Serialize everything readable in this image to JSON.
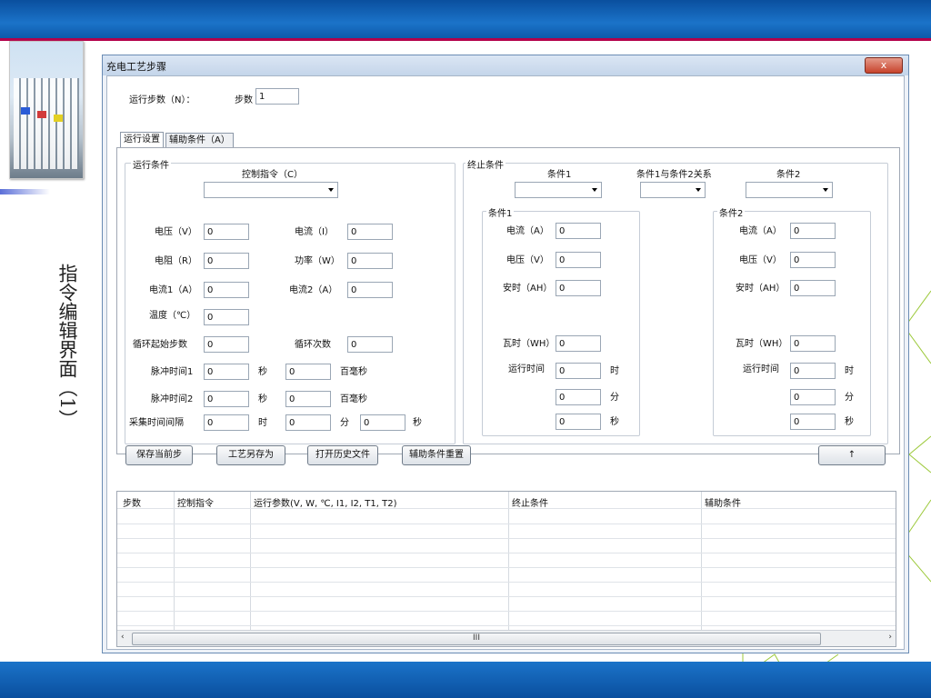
{
  "slide": {
    "title": "指令编辑界面（1）"
  },
  "window": {
    "title": "充电工艺步骤",
    "close_glyph": "x"
  },
  "header": {
    "run_step_label": "运行步数（N）：",
    "step_label": "步数",
    "step_value": "1"
  },
  "tabs": [
    {
      "label": "运行设置"
    },
    {
      "label": "辅助条件（A）"
    }
  ],
  "run_conditions": {
    "group_title": "运行条件",
    "control_label": "控制指令（C）",
    "voltage_label": "电压（V）",
    "voltage_value": "0",
    "current_label": "电流（I）",
    "current_value": "0",
    "resistance_label": "电阻（R）",
    "resistance_value": "0",
    "power_label": "功率（W）",
    "power_value": "0",
    "current1_label": "电流1（A）",
    "current1_value": "0",
    "current2_label": "电流2（A）",
    "current2_value": "0",
    "temp_label": "温度（℃）",
    "temp_value": "0",
    "loop_start_label": "循环起始步数",
    "loop_start_value": "0",
    "loop_count_label": "循环次数",
    "loop_count_value": "0",
    "pulse1_label": "脉冲时间1",
    "pulse1_value": "0",
    "pulse1_unit": "秒",
    "pulse1_ms_value": "0",
    "pulse1_ms_unit": "百毫秒",
    "pulse2_label": "脉冲时间2",
    "pulse2_value": "0",
    "pulse2_unit": "秒",
    "pulse2_ms_value": "0",
    "pulse2_ms_unit": "百毫秒",
    "sample_label": "采集时间间隔",
    "sample_h_value": "0",
    "sample_h_unit": "时",
    "sample_m_value": "0",
    "sample_m_unit": "分",
    "sample_s_value": "0",
    "sample_s_unit": "秒"
  },
  "termination": {
    "group_title": "终止条件",
    "cond1_header": "条件1",
    "relation_header": "条件1与条件2关系",
    "cond2_header": "条件2",
    "cond1": {
      "title": "条件1",
      "current_label": "电流（A）",
      "current_value": "0",
      "voltage_label": "电压（V）",
      "voltage_value": "0",
      "ah_label": "安时（AH）",
      "ah_value": "0",
      "wh_label": "瓦时（WH）",
      "wh_value": "0",
      "runtime_label": "运行时间",
      "runtime_h_value": "0",
      "runtime_h_unit": "时",
      "runtime_m_value": "0",
      "runtime_m_unit": "分",
      "runtime_s_value": "0",
      "runtime_s_unit": "秒"
    },
    "cond2": {
      "title": "条件2",
      "current_label": "电流（A）",
      "current_value": "0",
      "voltage_label": "电压（V）",
      "voltage_value": "0",
      "ah_label": "安时（AH）",
      "ah_value": "0",
      "wh_label": "瓦时（WH）",
      "wh_value": "0",
      "runtime_label": "运行时间",
      "runtime_h_value": "0",
      "runtime_h_unit": "时",
      "runtime_m_value": "0",
      "runtime_m_unit": "分",
      "runtime_s_value": "0",
      "runtime_s_unit": "秒"
    }
  },
  "buttons": {
    "save_step": "保存当前步",
    "save_as": "工艺另存为",
    "open_history": "打开历史文件",
    "reset_aux": "辅助条件重置",
    "up_arrow": "↑"
  },
  "table": {
    "columns": [
      "步数",
      "控制指令",
      "运行参数(V, W, ℃, I1, I2, T1, T2)",
      "终止条件",
      "辅助条件"
    ],
    "scroll_left": "‹",
    "scroll_thumb": "III",
    "scroll_right": "›"
  }
}
